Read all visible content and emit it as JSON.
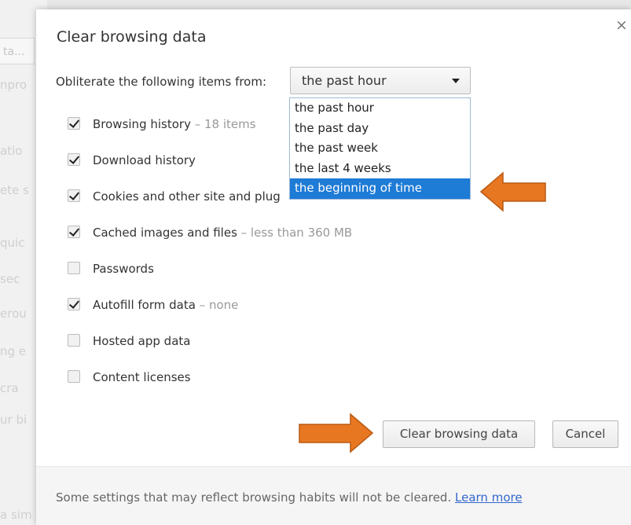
{
  "background": {
    "search_fragment": "ta...",
    "fragments": [
      "npro",
      "atio",
      "ete s",
      "quic",
      "sec",
      "erou",
      "ng e",
      "cra",
      "ur bi",
      "a sim"
    ]
  },
  "dialog": {
    "title": "Clear browsing data",
    "close_glyph": "×",
    "obliterate_label": "Obliterate the following items from:",
    "time_range": {
      "selected": "the past hour",
      "options": [
        "the past hour",
        "the past day",
        "the past week",
        "the last 4 weeks",
        "the beginning of time"
      ],
      "highlighted_index": 4
    },
    "items": [
      {
        "label": "Browsing history",
        "detail": "18 items",
        "checked": true
      },
      {
        "label": "Download history",
        "detail": "",
        "checked": true
      },
      {
        "label": "Cookies and other site and plug",
        "detail": "",
        "checked": true
      },
      {
        "label": "Cached images and files",
        "detail": "less than 360 MB",
        "checked": true
      },
      {
        "label": "Passwords",
        "detail": "",
        "checked": false
      },
      {
        "label": "Autofill form data",
        "detail": "none",
        "checked": true
      },
      {
        "label": "Hosted app data",
        "detail": "",
        "checked": false
      },
      {
        "label": "Content licenses",
        "detail": "",
        "checked": false
      }
    ],
    "clear_button": "Clear browsing data",
    "cancel_button": "Cancel",
    "footer_note": "Some settings that may reflect browsing habits will not be cleared.",
    "learn_more": "Learn more"
  },
  "annotations": {
    "arrow_color": "#e87722",
    "arrow_border": "#b85a12"
  }
}
